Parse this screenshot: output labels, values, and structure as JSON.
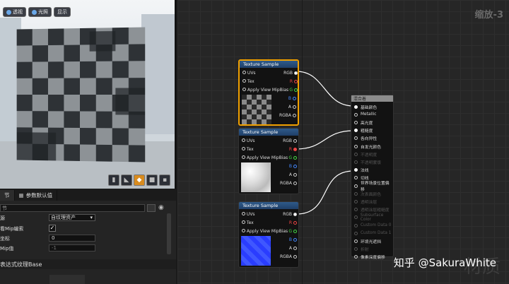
{
  "viewport": {
    "buttons": [
      {
        "label": "透视"
      },
      {
        "label": "光照"
      },
      {
        "label": "显示"
      }
    ]
  },
  "details": {
    "tabs": [
      {
        "label": "节"
      },
      {
        "label": "参数默认值"
      }
    ],
    "search_placeholder": "节",
    "rows": {
      "source_label": "源",
      "source_value": "自纹理资产",
      "mip_label": "看Mip编索",
      "coord_label": "坐标",
      "coord_value": "0",
      "mipval_label": "Mip值",
      "mipval_value": "-1"
    },
    "section_label": "表达式纹理Base"
  },
  "graph": {
    "zoom_label": "缩放-3",
    "watermark": "材质",
    "credit": "知乎 @SakuraWhite"
  },
  "nodes": [
    {
      "title": "Texture Sample",
      "inputs": [
        "UVs",
        "Tex",
        "Apply View MipBias"
      ],
      "outputs": [
        "RGB",
        "R",
        "G",
        "B",
        "A",
        "RGBA"
      ]
    },
    {
      "title": "Texture Sample",
      "inputs": [
        "UVs",
        "Tex",
        "Apply View MipBias"
      ],
      "outputs": [
        "RGB",
        "R",
        "G",
        "B",
        "A",
        "RGBA"
      ]
    },
    {
      "title": "Texture Sample",
      "inputs": [
        "UVs",
        "Tex",
        "Apply View MipBias"
      ],
      "outputs": [
        "RGB",
        "R",
        "G",
        "B",
        "A",
        "RGBA"
      ]
    }
  ],
  "material": {
    "title": "混合着",
    "pins": [
      "基础颜色",
      "Metallic",
      "高光度",
      "粗糙度",
      "各向异性",
      "自发光颜色",
      "不透明度",
      "不透明蒙版",
      "法线",
      "切线",
      "世界场景位置偏移",
      "次表面颜色",
      "透明涂层",
      "透明涂层粗糙度",
      "Subsurface Color",
      "Custom Data 0",
      "Custom Data 1",
      "环境光遮挡",
      "折射",
      "像素深度偏移"
    ],
    "dim": [
      false,
      false,
      false,
      false,
      false,
      false,
      true,
      true,
      false,
      false,
      false,
      true,
      true,
      true,
      true,
      true,
      true,
      false,
      true,
      false
    ]
  },
  "colors": {
    "accent": "#f0a000",
    "node_header": "#2f5a8a",
    "background": "#262626"
  }
}
